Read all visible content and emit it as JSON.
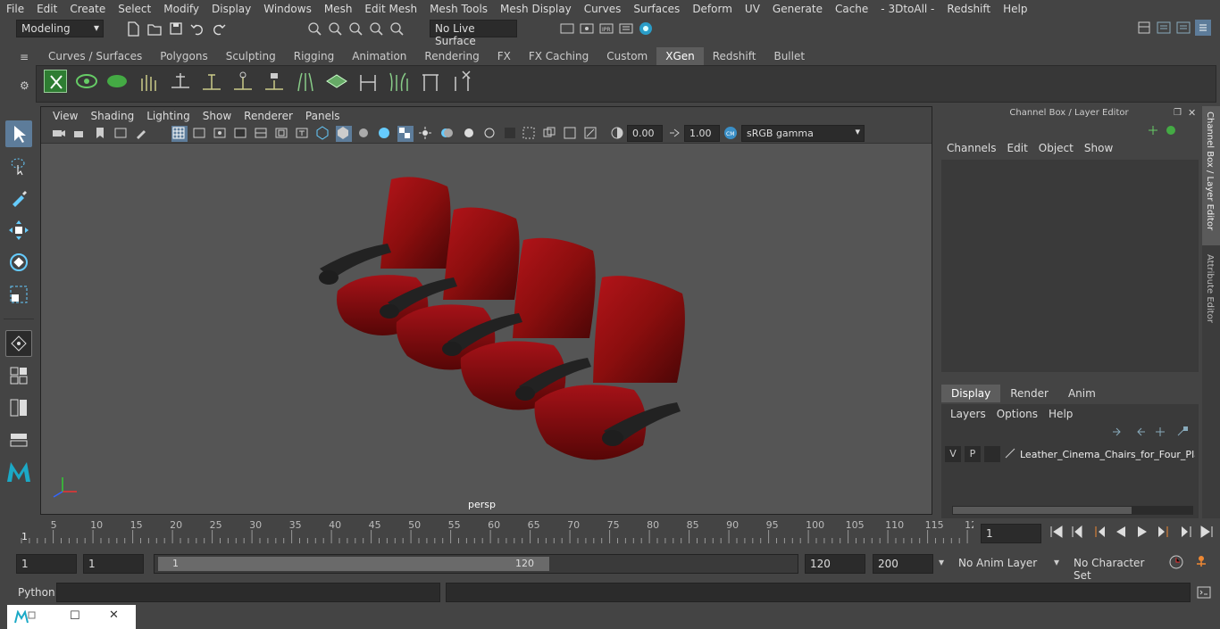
{
  "menubar": {
    "items": [
      "File",
      "Edit",
      "Create",
      "Select",
      "Modify",
      "Display",
      "Windows",
      "Mesh",
      "Edit Mesh",
      "Mesh Tools",
      "Mesh Display",
      "Curves",
      "Surfaces",
      "Deform",
      "UV",
      "Generate",
      "Cache",
      "- 3DtoAll -",
      "Redshift",
      "Help"
    ]
  },
  "status": {
    "mode": "Modeling",
    "live_surface": "No Live Surface"
  },
  "shelf": {
    "tabs": [
      "Curves / Surfaces",
      "Polygons",
      "Sculpting",
      "Rigging",
      "Animation",
      "Rendering",
      "FX",
      "FX Caching",
      "Custom",
      "XGen",
      "Redshift",
      "Bullet"
    ],
    "active": "XGen"
  },
  "viewport": {
    "menu": [
      "View",
      "Shading",
      "Lighting",
      "Show",
      "Renderer",
      "Panels"
    ],
    "exposure": "0.00",
    "gamma": "1.00",
    "color_space": "sRGB gamma",
    "camera_label": "persp"
  },
  "channel_box": {
    "title": "Channel Box / Layer Editor",
    "menu": [
      "Channels",
      "Edit",
      "Object",
      "Show"
    ],
    "tabs": [
      "Display",
      "Render",
      "Anim"
    ],
    "active_tab": "Display",
    "layer_menu": [
      "Layers",
      "Options",
      "Help"
    ],
    "layer": {
      "v": "V",
      "p": "P",
      "name": "Leather_Cinema_Chairs_for_Four_Plac"
    }
  },
  "side_tabs": [
    "Channel Box / Layer Editor",
    "Attribute Editor"
  ],
  "timeline": {
    "ticks": [
      "5",
      "10",
      "15",
      "20",
      "25",
      "30",
      "35",
      "40",
      "45",
      "50",
      "55",
      "60",
      "65",
      "70",
      "75",
      "80",
      "85",
      "90",
      "95",
      "100",
      "105",
      "110",
      "115",
      "12"
    ],
    "first": "1",
    "current_frame": "1"
  },
  "range": {
    "start": "1",
    "start2": "1",
    "slider_start": "1",
    "slider_end": "120",
    "end": "120",
    "end2": "200",
    "anim_layer": "No Anim Layer",
    "character_set": "No Character Set"
  },
  "command": {
    "label": "Python"
  },
  "colors": {
    "accent": "#5d7c9a",
    "chair": "#8b0e0e",
    "bg": "#444444"
  }
}
